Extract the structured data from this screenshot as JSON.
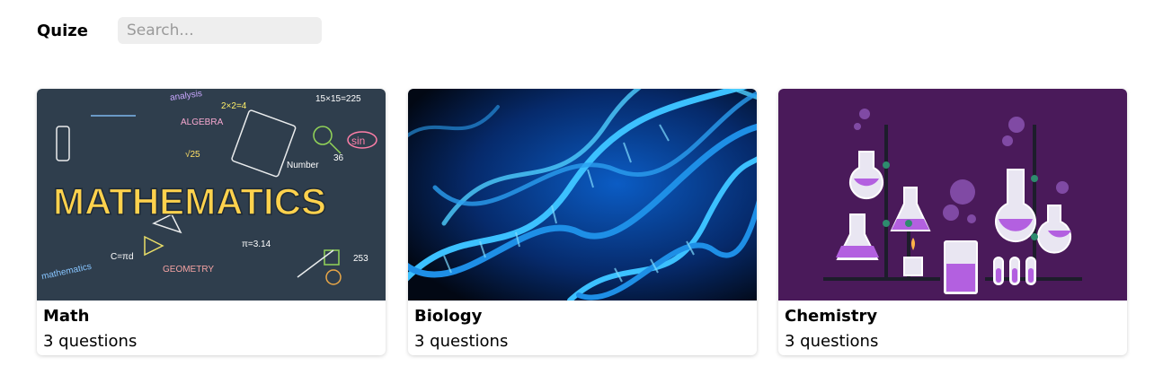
{
  "app": {
    "brand": "Quize",
    "search_placeholder": "Search..."
  },
  "cards": [
    {
      "title": "Math",
      "subtitle": "3 questions",
      "image_words": [
        "MATHEMATICS",
        "analysis",
        "ALGEBRA",
        "GEOMETRY",
        "mathematics",
        "Number",
        "15×15=225",
        "sin",
        "π=3.14",
        "2×2=4",
        "√25",
        "C=πd",
        "253",
        "36"
      ]
    },
    {
      "title": "Biology",
      "subtitle": "3 questions"
    },
    {
      "title": "Chemistry",
      "subtitle": "3 questions"
    }
  ]
}
